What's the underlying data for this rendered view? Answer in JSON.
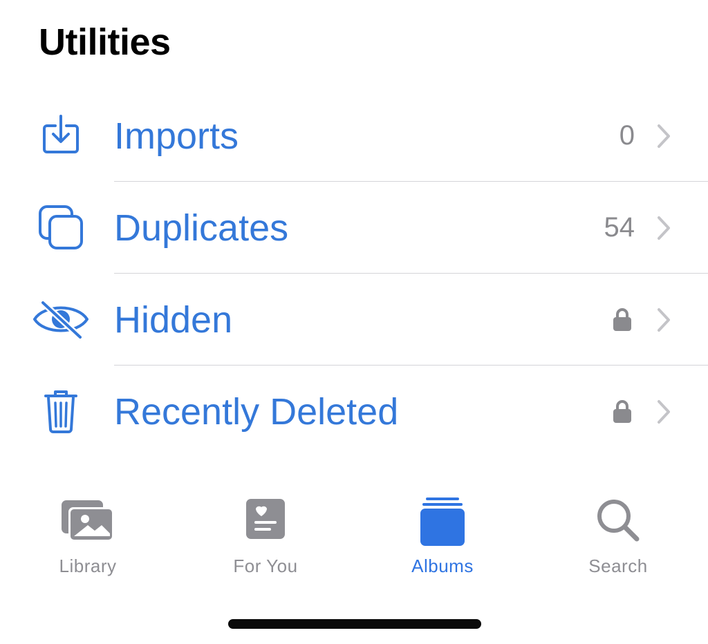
{
  "section": {
    "title": "Utilities"
  },
  "rows": [
    {
      "label": "Imports",
      "count": "0",
      "icon": "import-icon",
      "locked": false
    },
    {
      "label": "Duplicates",
      "count": "54",
      "icon": "duplicates-icon",
      "locked": false
    },
    {
      "label": "Hidden",
      "count": "",
      "icon": "eye-slash-icon",
      "locked": true
    },
    {
      "label": "Recently Deleted",
      "count": "",
      "icon": "trash-icon",
      "locked": true
    }
  ],
  "tabbar": {
    "tabs": [
      {
        "label": "Library",
        "icon": "photo-stack-icon",
        "active": false
      },
      {
        "label": "For You",
        "icon": "for-you-icon",
        "active": false
      },
      {
        "label": "Albums",
        "icon": "albums-icon",
        "active": true
      },
      {
        "label": "Search",
        "icon": "magnifier-icon",
        "active": false
      }
    ]
  },
  "colors": {
    "accent": "#3478d9",
    "secondary_text": "#8a8a8e",
    "tab_inactive": "#8e8e93",
    "tab_active": "#2f74e2"
  }
}
